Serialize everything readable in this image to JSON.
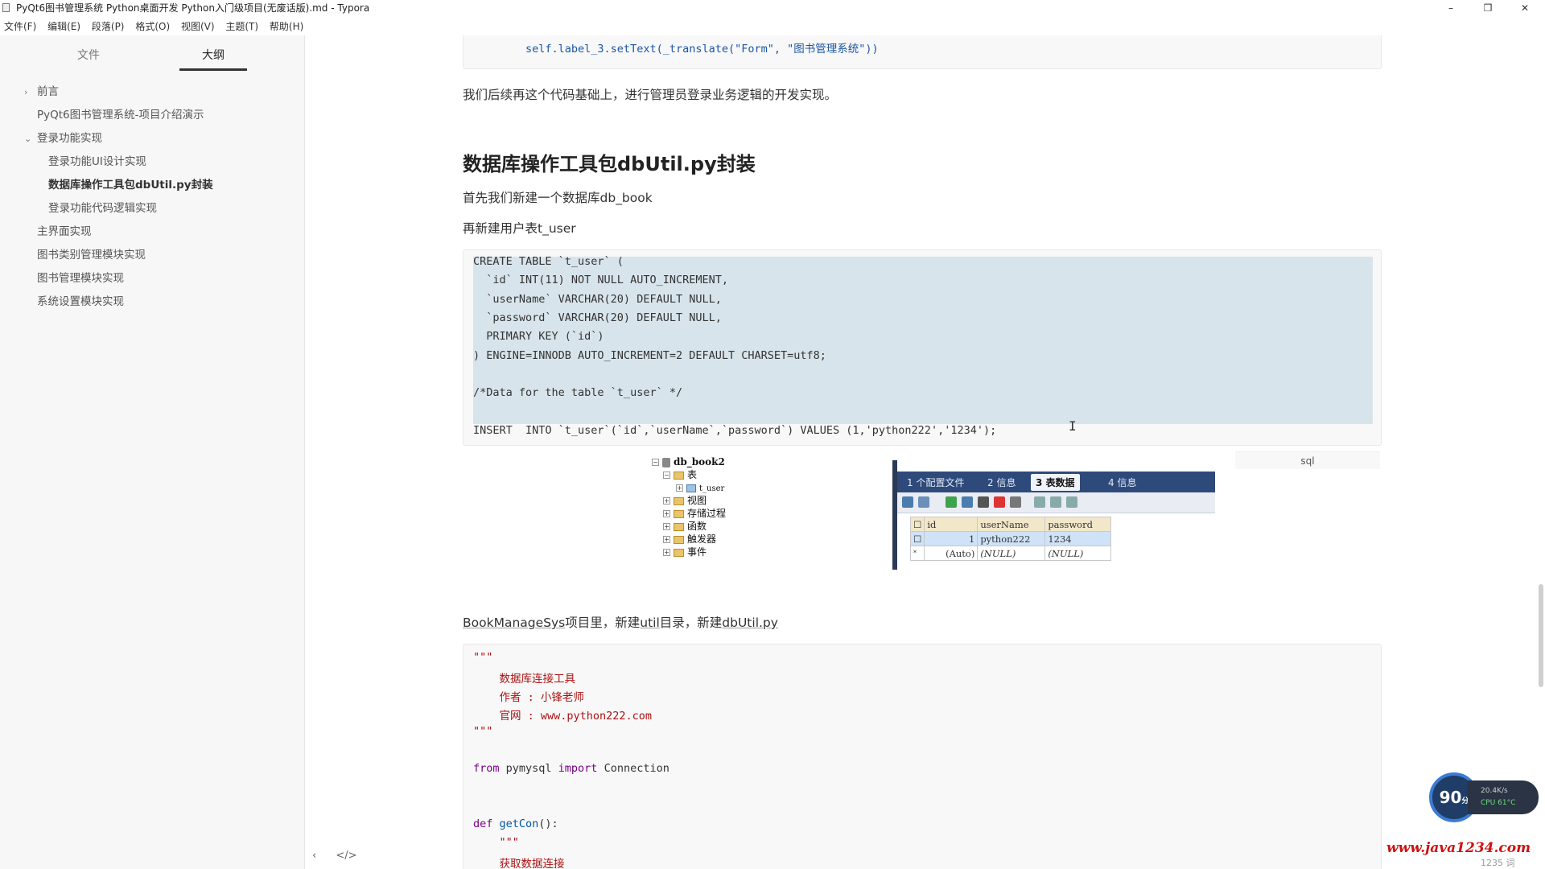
{
  "window": {
    "title": "PyQt6图书管理系统 Python桌面开发 Python入门级项目(无废话版).md - Typora",
    "minimize": "–",
    "maximize": "❐",
    "close": "✕"
  },
  "menu": [
    "文件(F)",
    "编辑(E)",
    "段落(P)",
    "格式(O)",
    "视图(V)",
    "主题(T)",
    "帮助(H)"
  ],
  "sidebar": {
    "tabs": [
      "文件",
      "大纲"
    ],
    "active_tab": "大纲",
    "outline": [
      {
        "label": "前言",
        "level": 1,
        "chevron": "›"
      },
      {
        "label": "PyQt6图书管理系统-项目介绍演示",
        "level": 1,
        "chevron": ""
      },
      {
        "label": "登录功能实现",
        "level": 1,
        "chevron": "⌄"
      },
      {
        "label": "登录功能UI设计实现",
        "level": 2,
        "chevron": ""
      },
      {
        "label": "数据库操作工具包dbUtil.py封装",
        "level": 2,
        "chevron": "",
        "active": true
      },
      {
        "label": "登录功能代码逻辑实现",
        "level": 2,
        "chevron": ""
      },
      {
        "label": "主界面实现",
        "level": 1,
        "chevron": ""
      },
      {
        "label": "图书类别管理模块实现",
        "level": 1,
        "chevron": ""
      },
      {
        "label": "图书管理模块实现",
        "level": 1,
        "chevron": ""
      },
      {
        "label": "系统设置模块实现",
        "level": 1,
        "chevron": ""
      }
    ],
    "bottom_back": "‹",
    "bottom_source": "</>"
  },
  "doc": {
    "top_code_line": "        self.label_3.setText(_translate(\"Form\", \"图书管理系统\"))",
    "para1": "我们后续再这个代码基础上，进行管理员登录业务逻辑的开发实现。",
    "heading": "数据库操作工具包dbUtil.py封装",
    "para2": "首先我们新建一个数据库db_book",
    "para3": "再新建用户表t_user",
    "sql_lines": [
      "CREATE TABLE `t_user` (",
      "  `id` INT(11) NOT NULL AUTO_INCREMENT,",
      "  `userName` VARCHAR(20) DEFAULT NULL,",
      "  `password` VARCHAR(20) DEFAULT NULL,",
      "  PRIMARY KEY (`id`)",
      ") ENGINE=INNODB AUTO_INCREMENT=2 DEFAULT CHARSET=utf8;",
      "",
      "/*Data for the table `t_user` */",
      "",
      "INSERT  INTO `t_user`(`id`,`userName`,`password`) VALUES (1,'python222','1234');"
    ],
    "lang": "sql",
    "para4_parts": [
      "BookManageSys",
      "项目里，新建",
      "util",
      "目录，新建",
      "dbUtil.py"
    ],
    "py_code": {
      "doc_open": "\"\"\"",
      "doc1": "    数据库连接工具",
      "doc2": "    作者 : 小锋老师",
      "doc3": "    官网 : www.python222.com",
      "doc_close": "\"\"\"",
      "imp_from": "from",
      "imp_mod": " pymysql ",
      "imp_import": "import",
      "imp_name": " Connection",
      "def_kw": "def",
      "def_name": " getCon",
      "def_rest": "():",
      "inner_doc": "    \"\"\"",
      "inner_doc1": "    获取数据连接"
    }
  },
  "embedded_screenshot": {
    "tree": [
      {
        "label": "db_book2",
        "indent": 0
      },
      {
        "label": "表",
        "indent": 1
      },
      {
        "label": "t_user",
        "indent": 2
      },
      {
        "label": "视图",
        "indent": 1
      },
      {
        "label": "存储过程",
        "indent": 1
      },
      {
        "label": "函数",
        "indent": 1
      },
      {
        "label": "触发器",
        "indent": 1
      },
      {
        "label": "事件",
        "indent": 1
      }
    ],
    "tabs": [
      "1 个配置文件",
      "2 信息",
      "3 表数据",
      "4 信息"
    ],
    "grid": {
      "headers": [
        "id",
        "userName",
        "password"
      ],
      "rows": [
        [
          "1",
          "python222",
          "1234"
        ],
        [
          "(Auto)",
          "(NULL)",
          "(NULL)"
        ]
      ]
    }
  },
  "status": {
    "score": "90",
    "score_unit": "分",
    "net": "20.4K/s",
    "cpu": "CPU 61°C",
    "watermark": "www.java1234.com",
    "wordcount": "1235 词"
  }
}
